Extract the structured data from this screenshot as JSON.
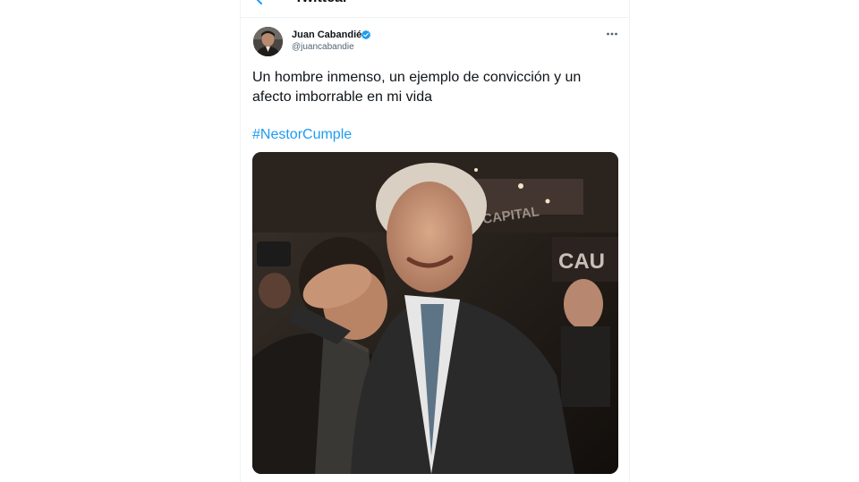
{
  "header": {
    "title": "Twittear",
    "back_icon": "arrow-left-icon"
  },
  "tweet": {
    "author_name": "Juan Cabandié",
    "author_handle": "@juancabandie",
    "verified": true,
    "verified_color": "#1d9bf0",
    "text_line1": "Un hombre inmenso, un ejemplo de convicción y un",
    "text_line2": "afecto imborrable en mi vida",
    "hashtag": "#NestorCumple",
    "hashtag_color": "#1d9bf0",
    "more_icon": "more-horizontal-icon"
  },
  "media": {
    "banner_texts": [
      "CAPITAL",
      "CAU"
    ]
  }
}
